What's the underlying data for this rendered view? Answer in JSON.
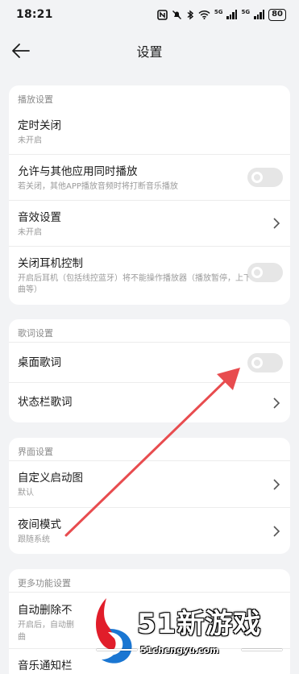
{
  "status": {
    "time": "18:21",
    "battery": "80",
    "signal1": "5G",
    "signal2": "5G"
  },
  "header": {
    "title": "设置"
  },
  "sections": {
    "playback": {
      "title": "播放设置",
      "timer": {
        "title": "定时关闭",
        "sub": "未开启"
      },
      "mix": {
        "title": "允许与其他应用同时播放",
        "sub": "若关闭，其他APP播放音频时将打断音乐播放",
        "enabled": false
      },
      "sound": {
        "title": "音效设置",
        "sub": "未开启"
      },
      "earphone": {
        "title": "关闭耳机控制",
        "sub": "开启后耳机（包括线控蓝牙）将不能操作播放器（播放暂停，上下曲等）",
        "enabled": false
      }
    },
    "lyrics": {
      "title": "歌词设置",
      "desktop": {
        "title": "桌面歌词",
        "enabled": false
      },
      "statusbar": {
        "title": "状态栏歌词"
      }
    },
    "interface": {
      "title": "界面设置",
      "splash": {
        "title": "自定义启动图",
        "sub": "默认"
      },
      "night": {
        "title": "夜间模式",
        "sub": "跟随系统"
      }
    },
    "more": {
      "title": "更多功能设置",
      "autodelete": {
        "title": "自动删除不",
        "sub": "开启后，自动删",
        "sub2": "曲"
      },
      "notify": {
        "title": "音乐通知栏"
      }
    }
  },
  "watermark": {
    "brand": "51新游戏",
    "url": "51chengyu.com"
  },
  "colors": {
    "arrow": "#e84c4f",
    "toggle_off": "#e6e6e6"
  }
}
